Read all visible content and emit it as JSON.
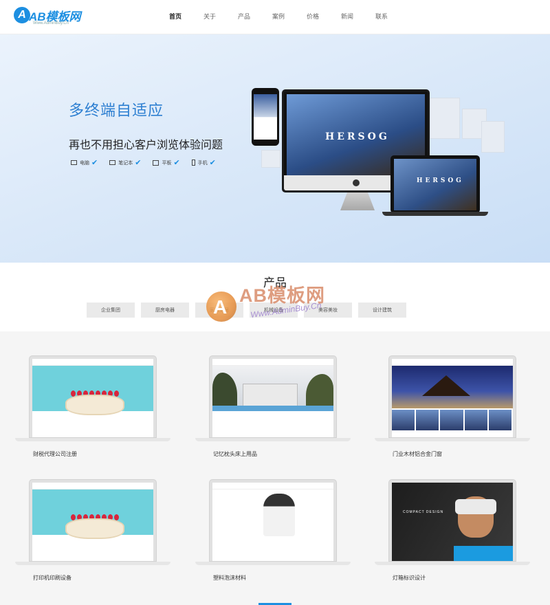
{
  "header": {
    "logo_mark": "A",
    "logo_text": "AB模板网",
    "logo_sub": "Www.AdminBuy.Cn",
    "nav": [
      "首页",
      "关于",
      "产品",
      "案例",
      "价格",
      "新闻",
      "联系"
    ]
  },
  "banner": {
    "title": "多终端自适应",
    "subtitle": "再也不用担心客户浏览体验问题",
    "devices": [
      {
        "label": "电脑",
        "icon": "monitor-icon"
      },
      {
        "label": "笔记本",
        "icon": "laptop-icon"
      },
      {
        "label": "平板",
        "icon": "tablet-icon"
      },
      {
        "label": "手机",
        "icon": "phone-icon"
      }
    ],
    "mock_brand": "HERSOG"
  },
  "products": {
    "title": "产品",
    "categories": [
      "企业集团",
      "厨房电器",
      "家具家居",
      "机械设备",
      "美容美妆",
      "设计建筑"
    ],
    "items": [
      {
        "label": "财税代理公司注册"
      },
      {
        "label": "记忆枕头床上用品"
      },
      {
        "label": "门业木材铝合金门窗"
      },
      {
        "label": "打印机印刷设备"
      },
      {
        "label": "塑料泡沫材料"
      },
      {
        "label": "灯箱标识设计"
      }
    ],
    "vr_caption": "COMPACT DESIGN"
  },
  "watermark": {
    "badge": "A",
    "text": "AB模板网",
    "url": "Www.AdminBuy.Cn"
  },
  "colors": {
    "accent": "#1d8fe1",
    "banner_title": "#2d7fd1"
  }
}
